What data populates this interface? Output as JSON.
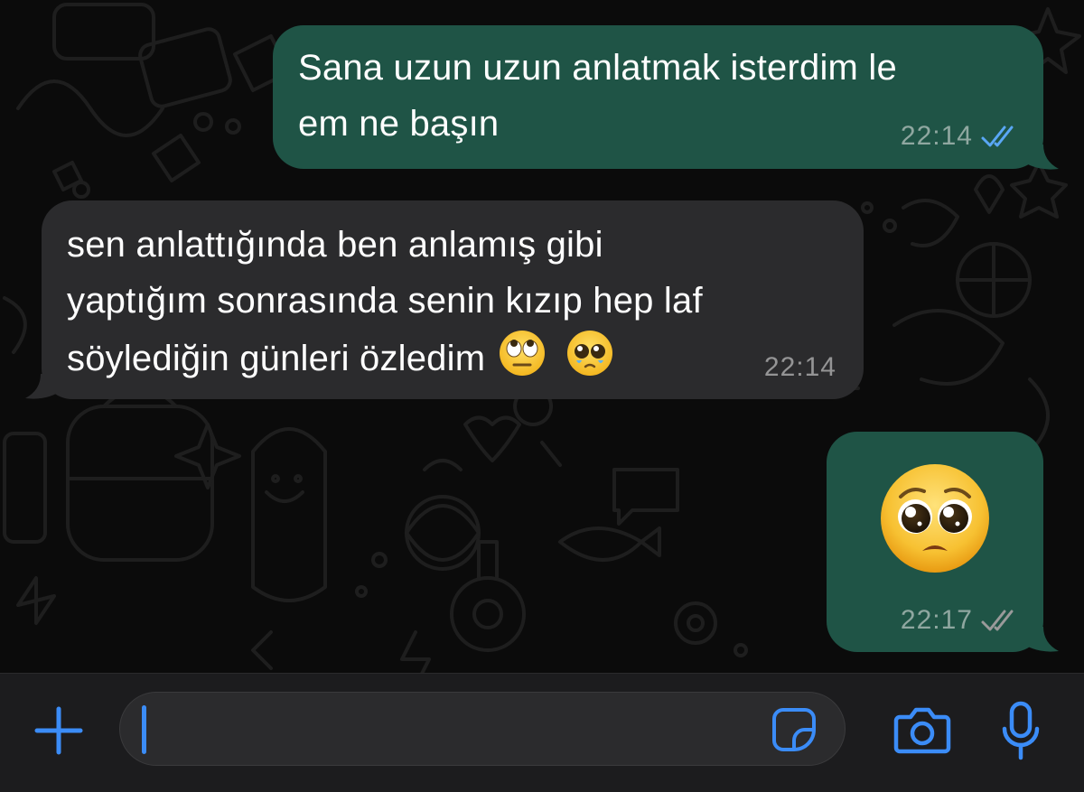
{
  "colors": {
    "accent": "#3b8cf7",
    "outgoing_bubble": "#1f5446",
    "incoming_bubble": "#2b2b2d",
    "read_receipt": "#5aa7f5",
    "delivered_receipt": "#9a9a9a"
  },
  "messages": [
    {
      "direction": "outgoing",
      "line1": "Sana uzun uzun anlatmak isterdim le",
      "line2": "em ne başın",
      "time": "22:14",
      "status": "read",
      "status_icon": "double-check-icon"
    },
    {
      "direction": "incoming",
      "line1": "sen anlattığında ben anlamış gibi",
      "line2": "yaptığım sonrasında senin kızıp hep laf",
      "line3": "söylediğin günleri özledim",
      "emojis": [
        "eye-roll-emoji",
        "pleading-emoji"
      ],
      "time": "22:14"
    },
    {
      "direction": "outgoing",
      "emoji": "pleading-face-emoji",
      "time": "22:17",
      "status": "delivered",
      "status_icon": "double-check-icon"
    }
  ],
  "composer": {
    "placeholder": "",
    "value": "",
    "icons": [
      "plus-icon",
      "sticker-icon",
      "camera-icon",
      "microphone-icon"
    ]
  }
}
